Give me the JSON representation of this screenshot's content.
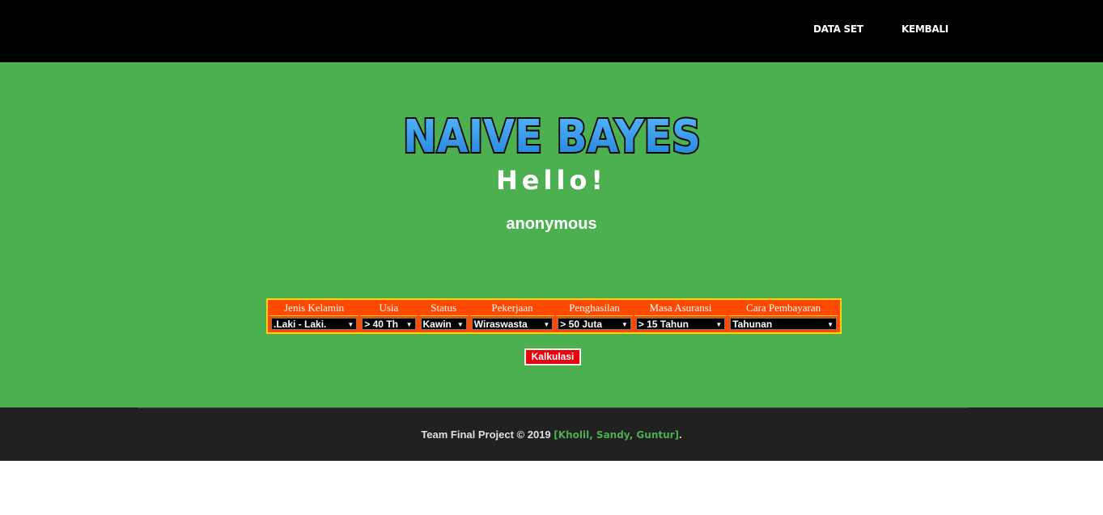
{
  "nav": {
    "items": [
      {
        "label": "DATA SET"
      },
      {
        "label": "KEMBALI"
      }
    ]
  },
  "hero": {
    "logo_text": "NAIVE BAYES",
    "greeting": "Hello!",
    "username": "anonymous"
  },
  "form": {
    "columns": [
      {
        "header": "Jenis Kelamin",
        "value": ".Laki - Laki."
      },
      {
        "header": "Usia",
        "value": "> 40 Th"
      },
      {
        "header": "Status",
        "value": "Kawin"
      },
      {
        "header": "Pekerjaan",
        "value": "Wiraswasta"
      },
      {
        "header": "Penghasilan",
        "value": "> 50 Juta"
      },
      {
        "header": "Masa Asuransi",
        "value": "> 15 Tahun"
      },
      {
        "header": "Cara Pembayaran",
        "value": "Tahunan"
      }
    ],
    "submit_label": "Kalkulasi"
  },
  "footer": {
    "text": "Team Final Project © 2019 ",
    "names": "[Kholil, Sandy, Guntur]",
    "suffix": "."
  },
  "colors": {
    "navbar": "#000000",
    "hero_bg": "#4caf50",
    "table_header": "#ff4800",
    "table_border": "#ffd400",
    "button": "#e8000d",
    "footer_bg": "#212121",
    "logo_fill": "#2f9df0"
  }
}
